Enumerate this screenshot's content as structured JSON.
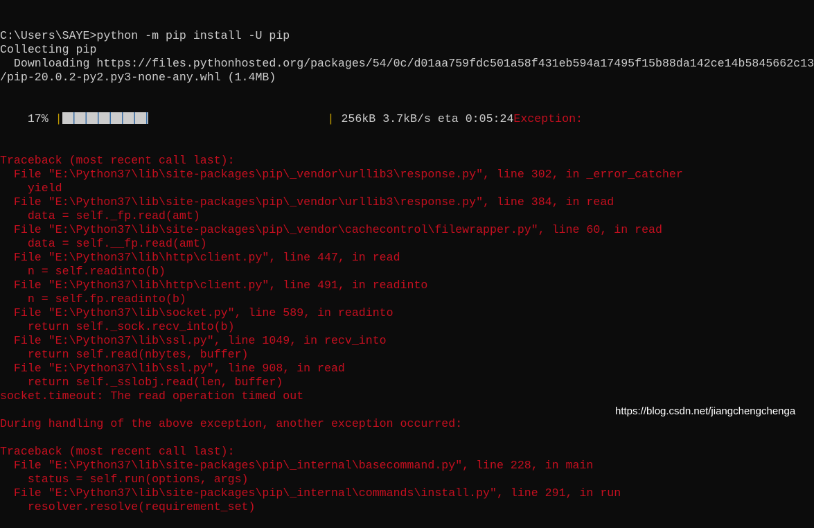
{
  "colors": {
    "background": "#0c0c0c",
    "text": "#cccccc",
    "error": "#c50f1f"
  },
  "lines_before": [
    {
      "text": "C:\\Users\\SAYE>python -m pip install -U pip",
      "color": "w"
    },
    {
      "text": "Collecting pip",
      "color": "w"
    },
    {
      "text": "  Downloading https://files.pythonhosted.org/packages/54/0c/d01aa759fdc501a58f431eb594a17495f15b88da142ce14b5845662c13",
      "color": "w"
    },
    {
      "text": "/pip-20.0.2-py2.py3-none-any.whl (1.4MB)",
      "color": "w"
    }
  ],
  "progress": {
    "percent_label": "    17% ",
    "percent": 17,
    "stats": " 256kB 3.7kB/s eta 0:05:24",
    "exception": "Exception:"
  },
  "lines_after": [
    {
      "text": "Traceback (most recent call last):",
      "color": "r"
    },
    {
      "text": "  File \"E:\\Python37\\lib\\site-packages\\pip\\_vendor\\urllib3\\response.py\", line 302, in _error_catcher",
      "color": "r"
    },
    {
      "text": "    yield",
      "color": "r"
    },
    {
      "text": "  File \"E:\\Python37\\lib\\site-packages\\pip\\_vendor\\urllib3\\response.py\", line 384, in read",
      "color": "r"
    },
    {
      "text": "    data = self._fp.read(amt)",
      "color": "r"
    },
    {
      "text": "  File \"E:\\Python37\\lib\\site-packages\\pip\\_vendor\\cachecontrol\\filewrapper.py\", line 60, in read",
      "color": "r"
    },
    {
      "text": "    data = self.__fp.read(amt)",
      "color": "r"
    },
    {
      "text": "  File \"E:\\Python37\\lib\\http\\client.py\", line 447, in read",
      "color": "r"
    },
    {
      "text": "    n = self.readinto(b)",
      "color": "r"
    },
    {
      "text": "  File \"E:\\Python37\\lib\\http\\client.py\", line 491, in readinto",
      "color": "r"
    },
    {
      "text": "    n = self.fp.readinto(b)",
      "color": "r"
    },
    {
      "text": "  File \"E:\\Python37\\lib\\socket.py\", line 589, in readinto",
      "color": "r"
    },
    {
      "text": "    return self._sock.recv_into(b)",
      "color": "r"
    },
    {
      "text": "  File \"E:\\Python37\\lib\\ssl.py\", line 1049, in recv_into",
      "color": "r"
    },
    {
      "text": "    return self.read(nbytes, buffer)",
      "color": "r"
    },
    {
      "text": "  File \"E:\\Python37\\lib\\ssl.py\", line 908, in read",
      "color": "r"
    },
    {
      "text": "    return self._sslobj.read(len, buffer)",
      "color": "r"
    },
    {
      "text": "socket.timeout: The read operation timed out",
      "color": "r"
    },
    {
      "text": "",
      "color": "r"
    },
    {
      "text": "During handling of the above exception, another exception occurred:",
      "color": "r"
    },
    {
      "text": "",
      "color": "r"
    },
    {
      "text": "Traceback (most recent call last):",
      "color": "r"
    },
    {
      "text": "  File \"E:\\Python37\\lib\\site-packages\\pip\\_internal\\basecommand.py\", line 228, in main",
      "color": "r"
    },
    {
      "text": "    status = self.run(options, args)",
      "color": "r"
    },
    {
      "text": "  File \"E:\\Python37\\lib\\site-packages\\pip\\_internal\\commands\\install.py\", line 291, in run",
      "color": "r"
    },
    {
      "text": "    resolver.resolve(requirement_set)",
      "color": "r"
    }
  ],
  "watermark": "https://blog.csdn.net/jiangchengchenga"
}
